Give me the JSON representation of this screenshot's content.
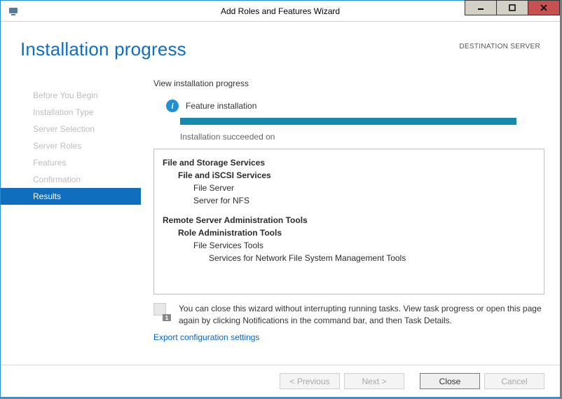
{
  "titlebar": {
    "title": "Add Roles and Features Wizard"
  },
  "header": {
    "page_title": "Installation progress",
    "destination_label": "DESTINATION SERVER"
  },
  "sidebar": {
    "items": [
      {
        "label": "Before You Begin"
      },
      {
        "label": "Installation Type"
      },
      {
        "label": "Server Selection"
      },
      {
        "label": "Server Roles"
      },
      {
        "label": "Features"
      },
      {
        "label": "Confirmation"
      },
      {
        "label": "Results"
      }
    ]
  },
  "main": {
    "view_label": "View installation progress",
    "info_text": "Feature installation",
    "status_text": "Installation succeeded on",
    "tree": {
      "g1_l0": "File and Storage Services",
      "g1_l1": "File and iSCSI Services",
      "g1_l2a": "File Server",
      "g1_l2b": "Server for NFS",
      "g2_l0": "Remote Server Administration Tools",
      "g2_l1": "Role Administration Tools",
      "g2_l2": "File Services Tools",
      "g2_l3": "Services for Network File System Management Tools"
    },
    "note_badge": "1",
    "note_text": "You can close this wizard without interrupting running tasks. View task progress or open this page again by clicking Notifications in the command bar, and then Task Details.",
    "export_link": "Export configuration settings"
  },
  "footer": {
    "previous": "< Previous",
    "next": "Next >",
    "close": "Close",
    "cancel": "Cancel"
  }
}
